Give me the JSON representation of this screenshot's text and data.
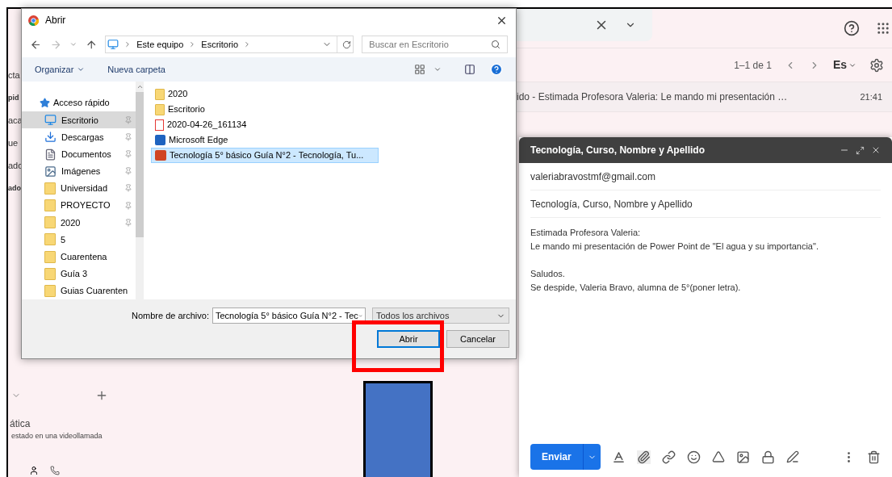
{
  "gmail": {
    "left_fragments": [
      {
        "text": "cta",
        "bold": false
      },
      {
        "text": "pid",
        "bold": true
      },
      {
        "text": "aca",
        "bold": false
      },
      {
        "text": "ue",
        "bold": false
      },
      {
        "text": "ado",
        "bold": false
      },
      {
        "text": "ado",
        "bold": true
      }
    ],
    "left_bottom": [
      "ática",
      "estado en una videollamada"
    ],
    "pagination": "1–1 de 1",
    "input_tool": "Es",
    "email_row": {
      "text": "ido - Estimada Profesora Valeria: Le mando mi presentación …",
      "time": "21:41"
    },
    "compose": {
      "title": "Tecnología, Curso, Nombre y Apellido",
      "to": "valeriabravostmf@gmail.com",
      "subject": "Tecnología, Curso, Nombre y Apellido",
      "body": [
        [
          "Estimada Profesora Valeria:",
          "Le mando mi presentación de Power Point de \"El agua y su importancia\"."
        ],
        [
          "Saludos.",
          "Se despide, Valeria Bravo, alumna de 5°(poner letra)."
        ]
      ],
      "send": "Enviar"
    }
  },
  "dialog": {
    "title": "Abrir",
    "breadcrumb": [
      "Este equipo",
      "Escritorio"
    ],
    "search": {
      "placeholder": "Buscar en Escritorio"
    },
    "organize": "Organizar",
    "new_folder": "Nueva carpeta",
    "sidebar": {
      "header": "Acceso rápido",
      "items": [
        {
          "label": "Escritorio",
          "kind": "desktop",
          "pinned": true,
          "selected": true
        },
        {
          "label": "Descargas",
          "kind": "download",
          "pinned": true,
          "selected": false
        },
        {
          "label": "Documentos",
          "kind": "document",
          "pinned": true,
          "selected": false
        },
        {
          "label": "Imágenes",
          "kind": "image",
          "pinned": true,
          "selected": false
        },
        {
          "label": "Universidad",
          "kind": "folder",
          "pinned": true,
          "selected": false
        },
        {
          "label": "PROYECTO",
          "kind": "folder",
          "pinned": true,
          "selected": false
        },
        {
          "label": "2020",
          "kind": "folder",
          "pinned": true,
          "selected": false
        },
        {
          "label": "5",
          "kind": "folder",
          "pinned": false,
          "selected": false
        },
        {
          "label": "Cuarentena",
          "kind": "folder",
          "pinned": false,
          "selected": false
        },
        {
          "label": "Guía 3",
          "kind": "folder",
          "pinned": false,
          "selected": false
        },
        {
          "label": "Guias Cuarenten",
          "kind": "folder",
          "pinned": false,
          "selected": false
        }
      ]
    },
    "files": [
      {
        "name": "2020",
        "kind": "folder",
        "selected": false
      },
      {
        "name": "Escritorio",
        "kind": "folder",
        "selected": false
      },
      {
        "name": "2020-04-26_161134",
        "kind": "pdf",
        "selected": false
      },
      {
        "name": "Microsoft Edge",
        "kind": "edge",
        "selected": false
      },
      {
        "name": "Tecnología 5° básico Guía N°2 - Tecnología, Tu...",
        "kind": "ppt",
        "selected": true
      }
    ],
    "filename_label": "Nombre de archivo:",
    "filename": {
      "value": "Tecnología 5° básico Guía N°2 - Tec"
    },
    "filter": {
      "value": "Todos los archivos"
    },
    "buttons": [
      {
        "label": "Abrir",
        "default": true
      },
      {
        "label": "Cancelar",
        "default": false
      }
    ]
  }
}
